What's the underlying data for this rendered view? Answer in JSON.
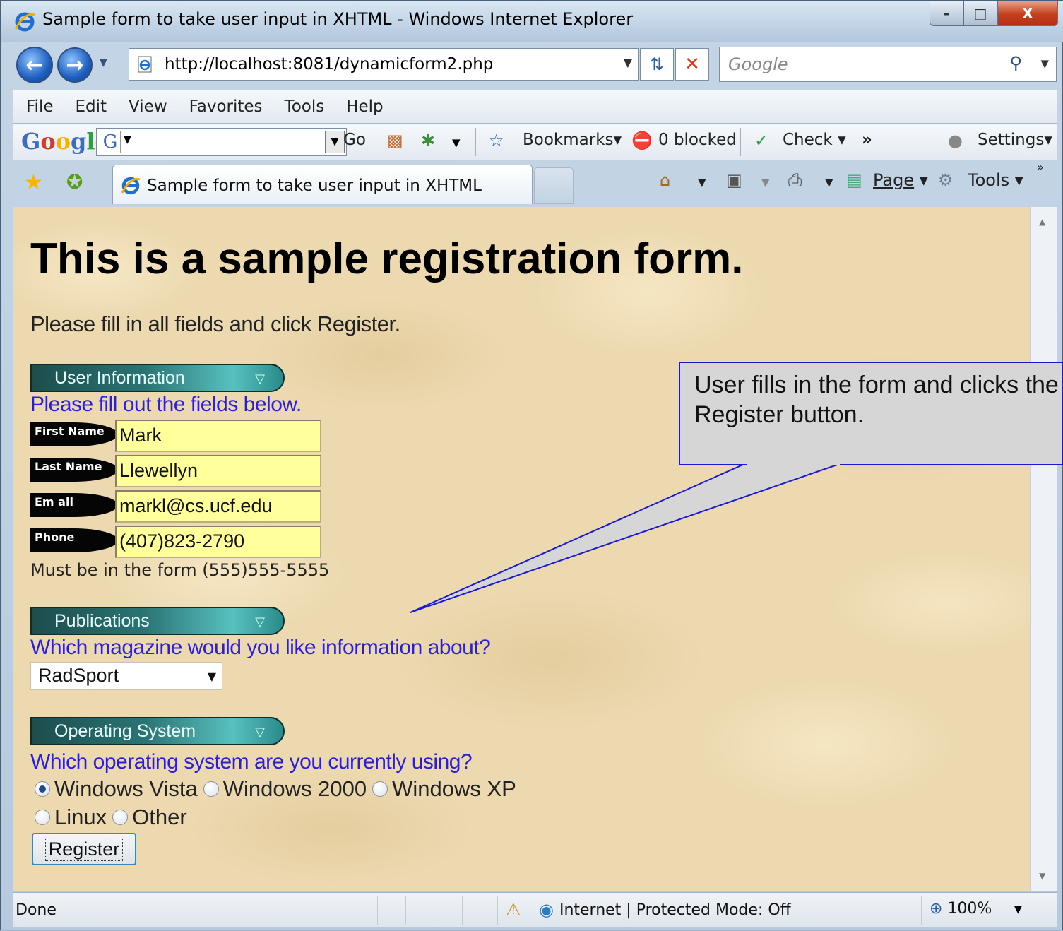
{
  "window": {
    "title": "Sample form to take user input in XHTML - Windows Internet Explorer",
    "min": "–",
    "max": "□",
    "close": "X"
  },
  "nav": {
    "url": "http://localhost:8081/dynamicform2.php",
    "search_placeholder": "Google"
  },
  "menu": [
    "File",
    "Edit",
    "View",
    "Favorites",
    "Tools",
    "Help"
  ],
  "google_toolbar": {
    "logo": "Google",
    "go": "Go",
    "bookmarks": "Bookmarks",
    "blocked": "0 blocked",
    "check": "Check",
    "more": "»",
    "settings": "Settings"
  },
  "tabs": {
    "active_title": "Sample form to take user input in XHTML",
    "page": "Page",
    "tools": "Tools"
  },
  "page": {
    "heading": "This is a sample registration form.",
    "intro": "Please fill in all fields and click Register.",
    "user_section": {
      "title": "User Information",
      "prompt": "Please fill out the fields below.",
      "fields": [
        {
          "label": "First Name",
          "value": "Mark"
        },
        {
          "label": "Last Name",
          "value": "Llewellyn"
        },
        {
          "label": "Em ail",
          "value": "markl@cs.ucf.edu"
        },
        {
          "label": "Phone",
          "value": "(407)823-2790"
        }
      ],
      "hint": "Must be in the form (555)555-5555"
    },
    "publications": {
      "title": "Publications",
      "prompt": "Which magazine would you like information about?",
      "selected": "RadSport"
    },
    "os": {
      "title": "Operating System",
      "prompt": "Which operating system are you currently using?",
      "options": [
        "Windows Vista",
        "Windows 2000",
        "Windows XP",
        "Linux",
        "Other"
      ],
      "selected": "Windows Vista"
    },
    "register_label": "Register"
  },
  "callout": {
    "text": "User fills in the form and clicks the Register button."
  },
  "status": {
    "left": "Done",
    "zone": "Internet | Protected Mode: Off",
    "zoom": "100%"
  },
  "colors": {
    "prompt_blue": "#2a1fd6",
    "field_yellow": "#ffff9c",
    "callout_border": "#1a1ad0",
    "section_teal": "#2b7474"
  }
}
